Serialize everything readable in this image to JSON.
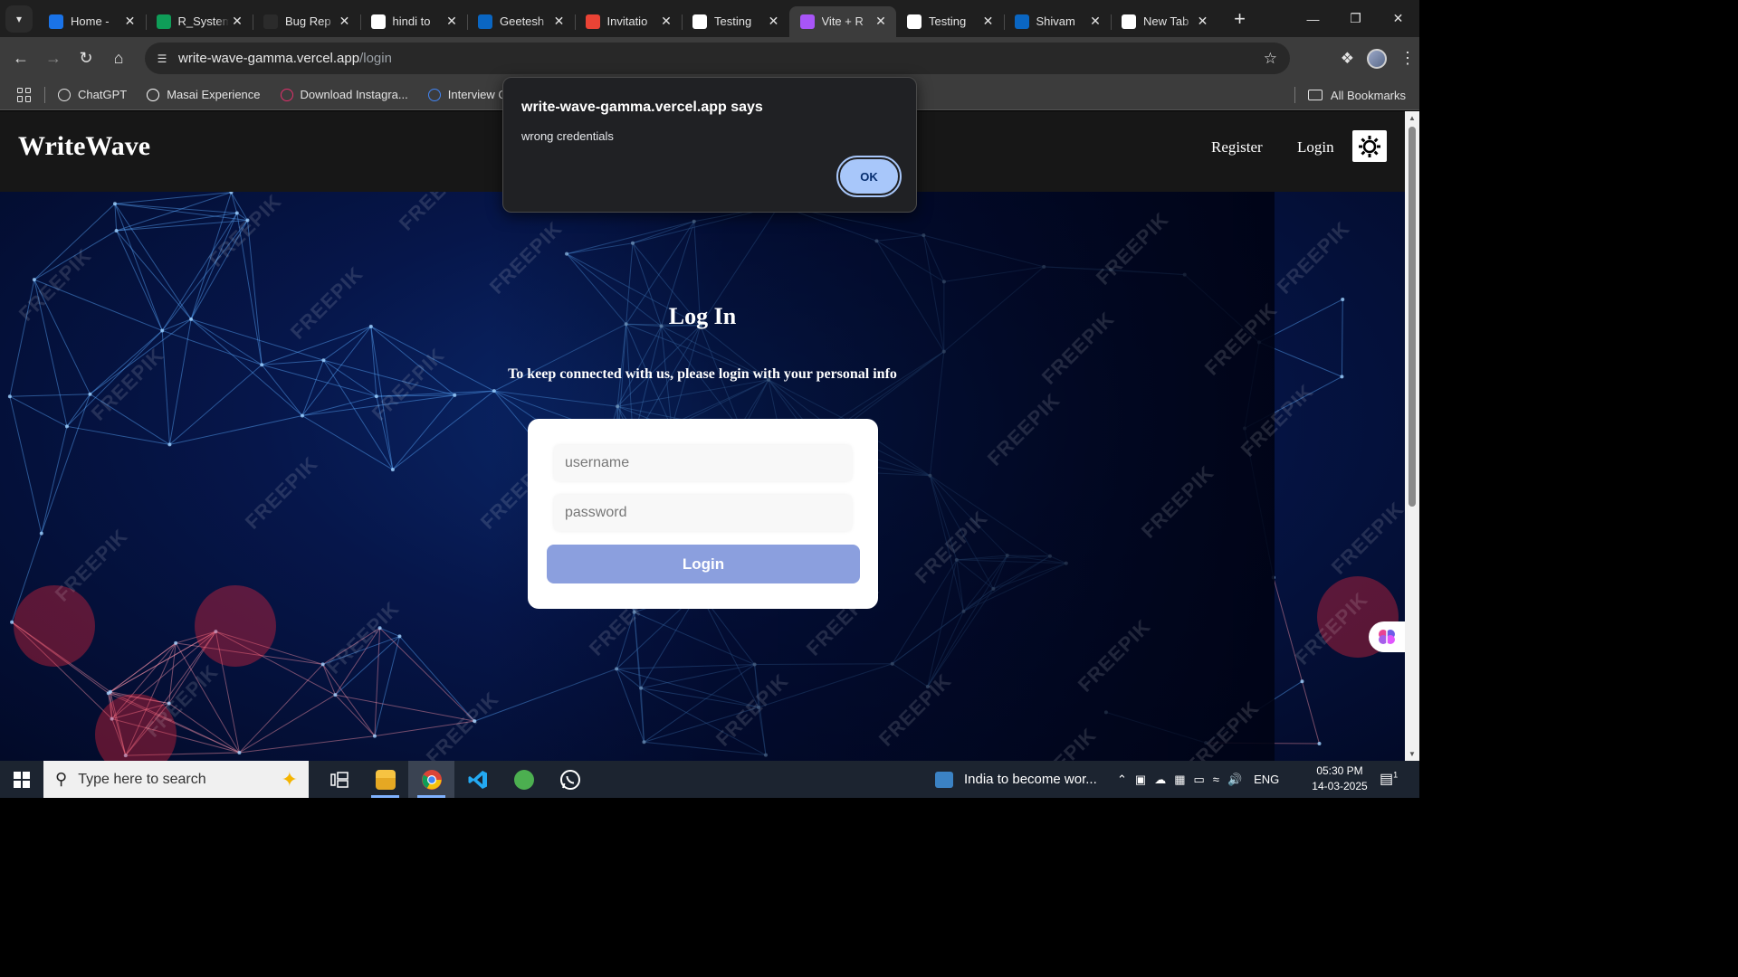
{
  "browser": {
    "tabs": [
      {
        "title": "Home -",
        "favicon": "google-drive-icon",
        "color": "#1a73e8"
      },
      {
        "title": "R_System",
        "favicon": "google-sheets-icon",
        "color": "#0f9d58"
      },
      {
        "title": "Bug Rep",
        "favicon": "chatgpt-icon",
        "color": "#2b2b2b"
      },
      {
        "title": "hindi to",
        "favicon": "google-icon",
        "color": "#ffffff"
      },
      {
        "title": "Geetesh",
        "favicon": "linkedin-icon",
        "color": "#0a66c2"
      },
      {
        "title": "Invitatio",
        "favicon": "gmail-icon",
        "color": "#ea4335"
      },
      {
        "title": "Testing",
        "favicon": "notion-icon",
        "color": "#ffffff"
      },
      {
        "title": "Vite + R",
        "favicon": "vite-icon",
        "color": "#a855f7",
        "active": true
      },
      {
        "title": "Testing",
        "favicon": "notion-icon",
        "color": "#ffffff"
      },
      {
        "title": "Shivam",
        "favicon": "linkedin-icon",
        "color": "#0a66c2"
      },
      {
        "title": "New Tab",
        "favicon": "chrome-icon",
        "color": "#ffffff"
      }
    ],
    "url_host": "write-wave-gamma.vercel.app",
    "url_path": "/login",
    "bookmarks": [
      {
        "label": "ChatGPT",
        "icon": "chatgpt-icon"
      },
      {
        "label": "Masai Experience",
        "icon": "masai-icon"
      },
      {
        "label": "Download Instagra...",
        "icon": "instagram-icon"
      },
      {
        "label": "Interview Questio",
        "icon": "docs-icon"
      }
    ],
    "all_bookmarks": "All Bookmarks"
  },
  "page": {
    "brand": "WriteWave",
    "nav_register": "Register",
    "nav_login": "Login",
    "theme_toggle_icon": "sun-icon",
    "title": "Log In",
    "subtitle": "To keep connected with us, please login with your personal info",
    "username_placeholder": "username",
    "password_placeholder": "password",
    "login_button": "Login",
    "watermark": "FREEPIK",
    "button_color": "#8b9fde"
  },
  "dialog": {
    "title": "write-wave-gamma.vercel.app says",
    "message": "wrong credentials",
    "ok_label": "OK"
  },
  "taskbar": {
    "search_placeholder": "Type here to search",
    "news": "India to become wor...",
    "lang": "ENG",
    "time": "05:30 PM",
    "date": "14-03-2025",
    "notification_count": "1"
  }
}
